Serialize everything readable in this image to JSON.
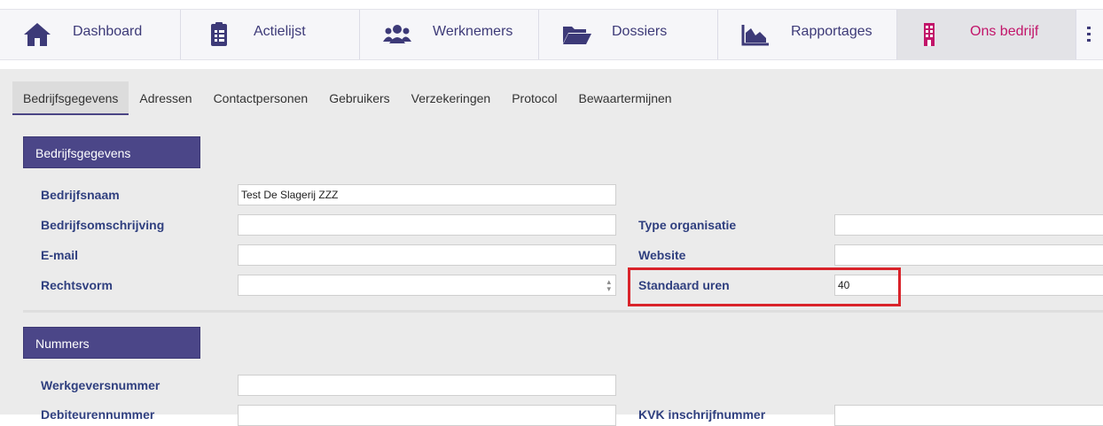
{
  "nav": {
    "items": [
      {
        "label": "Dashboard",
        "icon": "home-icon"
      },
      {
        "label": "Actielijst",
        "icon": "clipboard-list-icon"
      },
      {
        "label": "Werknemers",
        "icon": "users-icon"
      },
      {
        "label": "Dossiers",
        "icon": "folder-open-icon"
      },
      {
        "label": "Rapportages",
        "icon": "area-chart-icon"
      },
      {
        "label": "Ons bedrijf",
        "icon": "building-icon"
      }
    ],
    "accent_color": "#c2156a",
    "text_color": "#3d3a78"
  },
  "subtabs": [
    "Bedrijfsgegevens",
    "Adressen",
    "Contactpersonen",
    "Gebruikers",
    "Verzekeringen",
    "Protocol",
    "Bewaartermijnen"
  ],
  "section1": {
    "title": "Bedrijfsgegevens",
    "fields": {
      "bedrijfsnaam": {
        "label": "Bedrijfsnaam",
        "value": "Test De Slagerij ZZZ"
      },
      "bedrijfsomschrijving": {
        "label": "Bedrijfsomschrijving",
        "value": ""
      },
      "email": {
        "label": "E-mail",
        "value": ""
      },
      "rechtsvorm": {
        "label": "Rechtsvorm",
        "value": ""
      },
      "type_organisatie": {
        "label": "Type organisatie",
        "value": ""
      },
      "website": {
        "label": "Website",
        "value": ""
      },
      "standaard_uren": {
        "label": "Standaard uren",
        "value": "40"
      }
    }
  },
  "section2": {
    "title": "Nummers",
    "fields": {
      "werkgeversnummer": {
        "label": "Werkgeversnummer",
        "value": ""
      },
      "debiteurennummer": {
        "label": "Debiteurennummer",
        "value": ""
      },
      "kvk": {
        "label": "KVK inschrijfnummer",
        "value": ""
      }
    }
  },
  "annotation_color": "#d9232a"
}
